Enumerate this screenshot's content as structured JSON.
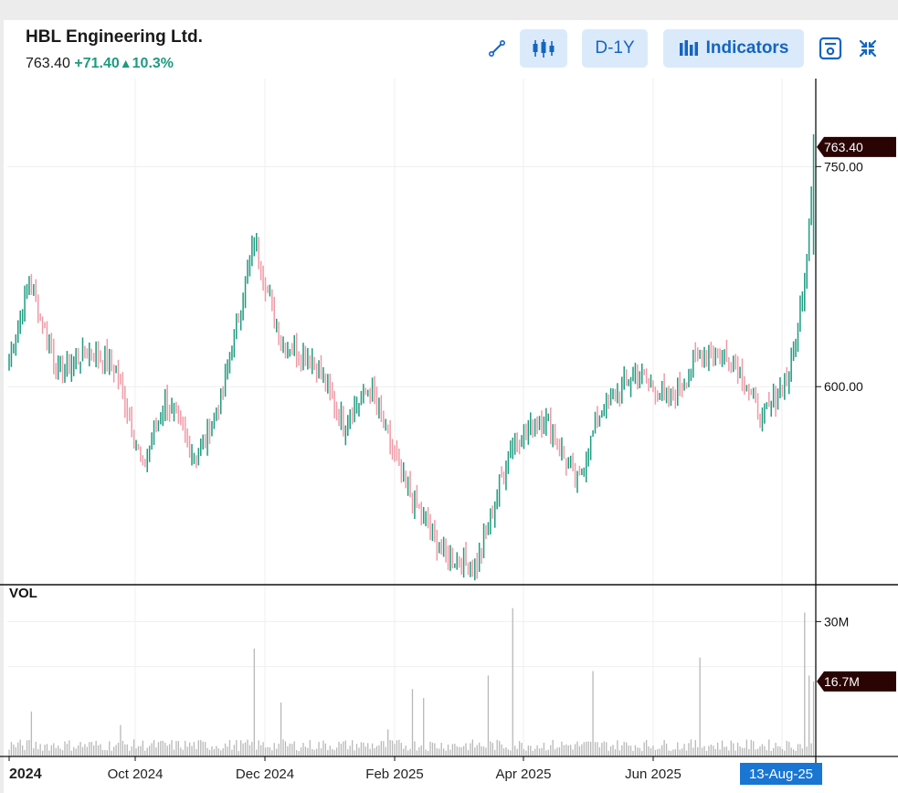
{
  "header": {
    "company": "HBL Engineering Ltd.",
    "last_price": "763.40",
    "change": "+71.40",
    "change_pct": "10.3%",
    "up_arrow": "▲"
  },
  "toolbar": {
    "draw_icon": "line-draw-icon",
    "candle_icon": "candlestick-icon",
    "range_label": "D-1Y",
    "indicators_label": "Indicators",
    "save_icon": "save-icon",
    "collapse_icon": "collapse-icon"
  },
  "colors": {
    "up": "#1e9b80",
    "down": "#ef9aa6",
    "accent": "#1565c0",
    "tag_bg": "#2a0303",
    "date_tag_bg": "#1976d2"
  },
  "chart_data": {
    "type": "candlestick",
    "x_tick_labels": [
      "2024",
      "Oct 2024",
      "Dec 2024",
      "Feb 2025",
      "Apr 2025",
      "Jun 2025"
    ],
    "price_axis": {
      "ticks": [
        600,
        750
      ],
      "tick_labels": [
        "600.00",
        "750.00"
      ],
      "ylim": [
        465,
        810
      ]
    },
    "volume_axis": {
      "ticks": [
        20,
        30
      ],
      "tick_labels": [
        "30M"
      ],
      "ylim": [
        0,
        38
      ],
      "unit": "M"
    },
    "last_price_tag": "763.40",
    "last_volume_tag": "16.7M",
    "crosshair_date": "13-Aug-25",
    "volume_title": "VOL",
    "key_points": [
      {
        "i": 0,
        "price": 620
      },
      {
        "i": 9,
        "price": 672
      },
      {
        "i": 22,
        "price": 610
      },
      {
        "i": 36,
        "price": 625
      },
      {
        "i": 48,
        "price": 612
      },
      {
        "i": 60,
        "price": 545
      },
      {
        "i": 70,
        "price": 590
      },
      {
        "i": 84,
        "price": 552
      },
      {
        "i": 95,
        "price": 590
      },
      {
        "i": 110,
        "price": 700
      },
      {
        "i": 122,
        "price": 630
      },
      {
        "i": 136,
        "price": 620
      },
      {
        "i": 150,
        "price": 575
      },
      {
        "i": 162,
        "price": 600
      },
      {
        "i": 176,
        "price": 538
      },
      {
        "i": 195,
        "price": 485
      },
      {
        "i": 210,
        "price": 478
      },
      {
        "i": 225,
        "price": 560
      },
      {
        "i": 240,
        "price": 580
      },
      {
        "i": 255,
        "price": 535
      },
      {
        "i": 266,
        "price": 585
      },
      {
        "i": 282,
        "price": 610
      },
      {
        "i": 296,
        "price": 590
      },
      {
        "i": 312,
        "price": 625
      },
      {
        "i": 325,
        "price": 620
      },
      {
        "i": 338,
        "price": 578
      },
      {
        "i": 350,
        "price": 608
      },
      {
        "i": 354,
        "price": 640
      },
      {
        "i": 358,
        "price": 692
      },
      {
        "i": 361,
        "price": 763.4
      }
    ],
    "volume_spikes": [
      {
        "i": 10,
        "value": 10
      },
      {
        "i": 50,
        "value": 7
      },
      {
        "i": 110,
        "value": 24
      },
      {
        "i": 122,
        "value": 12
      },
      {
        "i": 170,
        "value": 6
      },
      {
        "i": 181,
        "value": 15
      },
      {
        "i": 186,
        "value": 13
      },
      {
        "i": 215,
        "value": 18
      },
      {
        "i": 226,
        "value": 33
      },
      {
        "i": 262,
        "value": 19
      },
      {
        "i": 310,
        "value": 22
      },
      {
        "i": 357,
        "value": 32
      },
      {
        "i": 359,
        "value": 18
      },
      {
        "i": 361,
        "value": 16.7
      }
    ]
  }
}
